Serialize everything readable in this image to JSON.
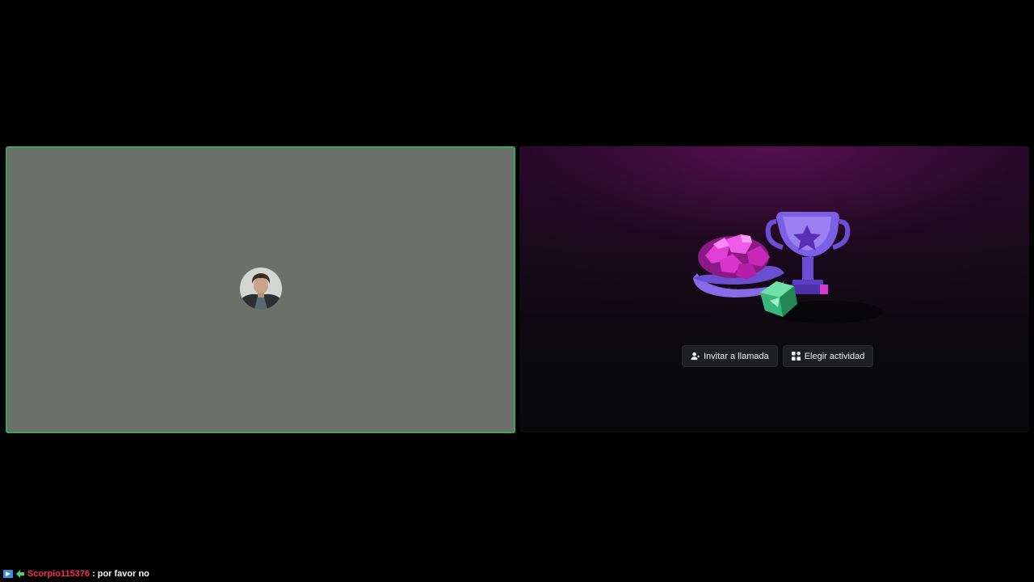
{
  "call": {
    "participant_tile": {
      "speaking": true,
      "border_color": "#3ba55c",
      "background_color": "#6b7069"
    },
    "activity_panel": {
      "illustration": "trophy-gems-dice-icon",
      "buttons": {
        "invite_label": "Invitar a llamada",
        "invite_icon": "add-person-icon",
        "activity_label": "Elegir actividad",
        "activity_icon": "apps-grid-icon"
      }
    }
  },
  "chat": {
    "badges": [
      "prime-badge-icon",
      "chevron-badge-icon"
    ],
    "username": "Scorpio115376",
    "separator": ":",
    "message": "por favor no",
    "username_color": "#ff2b5c"
  }
}
